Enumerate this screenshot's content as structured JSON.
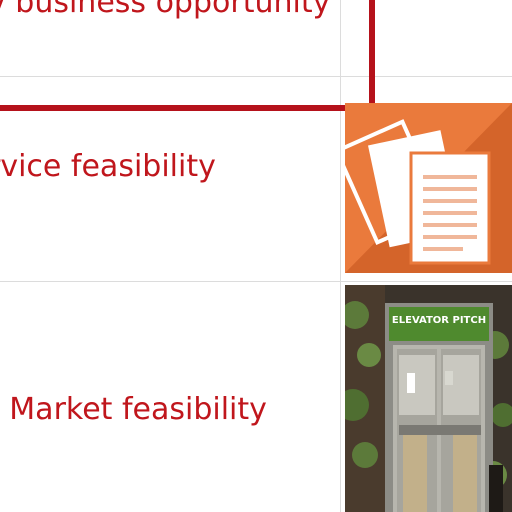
{
  "rows": [
    {
      "label": "v business opportunity"
    },
    {
      "label": "rvice feasibility"
    },
    {
      "label": "t Market feasibility"
    }
  ],
  "thumbnails": [
    {
      "icon": "documents-icon",
      "background": "#ea7a3c"
    },
    {
      "icon": "elevator-photo",
      "sign_text": "ELEVATOR PITCH"
    }
  ],
  "colors": {
    "link": "#c0161c",
    "selection_border": "#b5121b",
    "grid": "#dcdcdc"
  }
}
